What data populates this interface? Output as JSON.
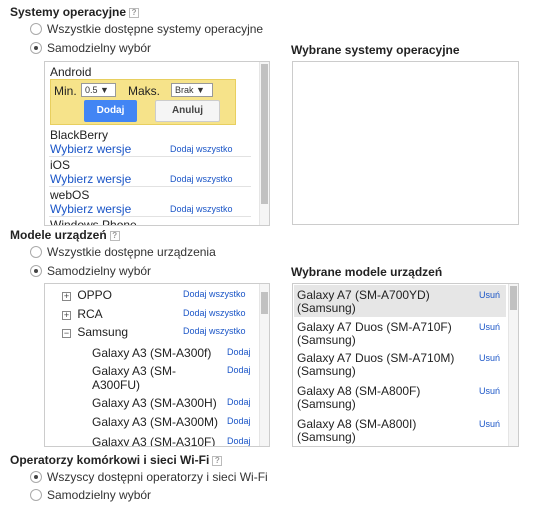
{
  "os_section": {
    "title": "Systemy operacyjne",
    "help": "?",
    "option_all": "Wszystkie dostępne systemy operacyjne",
    "option_custom": "Samodzielny wybór",
    "selected_title": "Wybrane systemy operacyjne",
    "android": {
      "name": "Android",
      "min_label": "Min.",
      "min_value": "0.5 ▼",
      "max_label": "Maks.",
      "max_value": "Brak ▼",
      "add_button": "Dodaj",
      "cancel_button": "Anuluj"
    },
    "items": [
      {
        "name": "BlackBerry",
        "choose": "Wybierz wersje",
        "add_all": "Dodaj wszystko"
      },
      {
        "name": "iOS",
        "choose": "Wybierz wersje",
        "add_all": "Dodaj wszystko"
      },
      {
        "name": "webOS",
        "choose": "Wybierz wersje",
        "add_all": "Dodaj wszystko"
      },
      {
        "name": "Windows Phone"
      }
    ]
  },
  "device_section": {
    "title": "Modele urządzeń",
    "help": "?",
    "option_all": "Wszystkie dostępne urządzenia",
    "option_custom": "Samodzielny wybór",
    "selected_title": "Wybrane modele urządzeń",
    "tree": [
      {
        "name": "OPPO",
        "toggle": "+",
        "action": "Dodaj wszystko"
      },
      {
        "name": "RCA",
        "toggle": "+",
        "action": "Dodaj wszystko"
      },
      {
        "name": "Samsung",
        "toggle": "−",
        "action": "Dodaj wszystko"
      }
    ],
    "models": [
      {
        "line1": "Galaxy A3 (SM-A300f)",
        "line2": "",
        "action": "Dodaj"
      },
      {
        "line1": "Galaxy A3 (SM-",
        "line2": "A300FU)",
        "action": "Dodaj"
      },
      {
        "line1": "Galaxy A3 (SM-A300H)",
        "line2": "",
        "action": "Dodaj"
      },
      {
        "line1": "Galaxy A3 (SM-A300M)",
        "line2": "",
        "action": "Dodaj"
      },
      {
        "line1": "Galaxy A3 (SM-A310F)",
        "line2": "",
        "action": "Dodaj"
      }
    ],
    "selected": [
      {
        "line1": "Galaxy A7 (SM-A700YD)",
        "line2": "(Samsung)",
        "action": "Usuń"
      },
      {
        "line1": "Galaxy A7 Duos (SM-A710F)",
        "line2": "(Samsung)",
        "action": "Usuń"
      },
      {
        "line1": "Galaxy A7 Duos (SM-A710M)",
        "line2": "(Samsung)",
        "action": "Usuń"
      },
      {
        "line1": "Galaxy A8 (SM-A800F)",
        "line2": "(Samsung)",
        "action": "Usuń"
      },
      {
        "line1": "Galaxy A8 (SM-A800I)",
        "line2": "(Samsung)",
        "action": "Usuń"
      }
    ]
  },
  "carrier_section": {
    "title": "Operatorzy komórkowi i sieci Wi-Fi",
    "help": "?",
    "option_all": "Wszyscy dostępni operatorzy i sieci Wi-Fi",
    "option_custom": "Samodzielny wybór"
  }
}
